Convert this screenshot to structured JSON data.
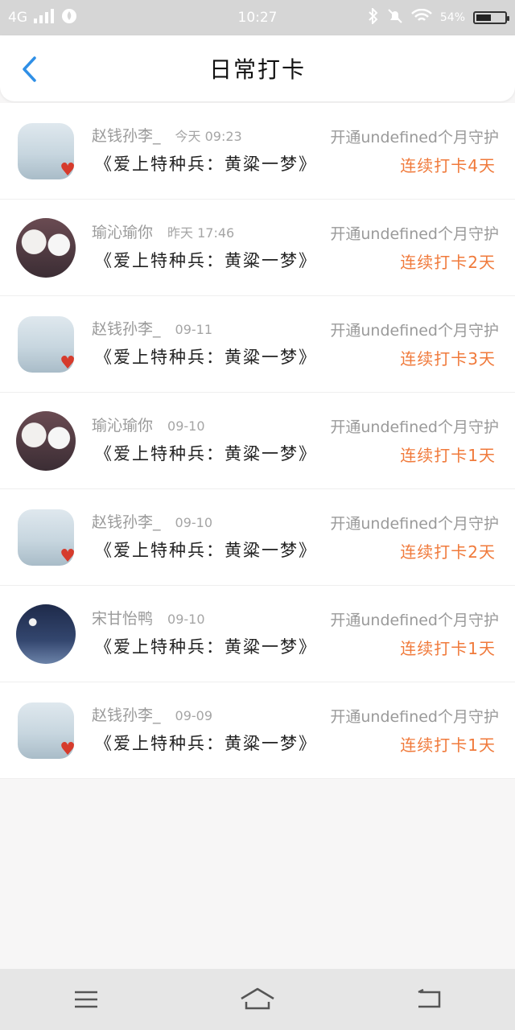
{
  "status_bar": {
    "network": "4G",
    "time": "10:27",
    "battery_text": "54%",
    "battery_level": 0.54
  },
  "header": {
    "title": "日常打卡"
  },
  "entries": [
    {
      "name": "赵钱孙李_",
      "time": "今天 09:23",
      "book": "《爱上特种兵：黄粱一梦》",
      "guard": "开通undefined个月守护",
      "streak": "连续打卡4天",
      "avatar": "landscape"
    },
    {
      "name": "瑜沁瑜你",
      "time": "昨天 17:46",
      "book": "《爱上特种兵：黄粱一梦》",
      "guard": "开通undefined个月守护",
      "streak": "连续打卡2天",
      "avatar": "couple"
    },
    {
      "name": "赵钱孙李_",
      "time": "09-11",
      "book": "《爱上特种兵：黄粱一梦》",
      "guard": "开通undefined个月守护",
      "streak": "连续打卡3天",
      "avatar": "landscape"
    },
    {
      "name": "瑜沁瑜你",
      "time": "09-10",
      "book": "《爱上特种兵：黄粱一梦》",
      "guard": "开通undefined个月守护",
      "streak": "连续打卡1天",
      "avatar": "couple"
    },
    {
      "name": "赵钱孙李_",
      "time": "09-10",
      "book": "《爱上特种兵：黄粱一梦》",
      "guard": "开通undefined个月守护",
      "streak": "连续打卡2天",
      "avatar": "landscape"
    },
    {
      "name": "宋甘怡鸭",
      "time": "09-10",
      "book": "《爱上特种兵：黄粱一梦》",
      "guard": "开通undefined个月守护",
      "streak": "连续打卡1天",
      "avatar": "night-sky"
    },
    {
      "name": "赵钱孙李_",
      "time": "09-09",
      "book": "《爱上特种兵：黄粱一梦》",
      "guard": "开通undefined个月守护",
      "streak": "连续打卡1天",
      "avatar": "landscape"
    }
  ],
  "nav_bar": {
    "menu_icon": "menu-icon",
    "home_icon": "home-icon",
    "back_icon": "back-arrow-icon"
  },
  "colors": {
    "streak": "#f07a3b",
    "back_arrow": "#2f8fe6"
  }
}
